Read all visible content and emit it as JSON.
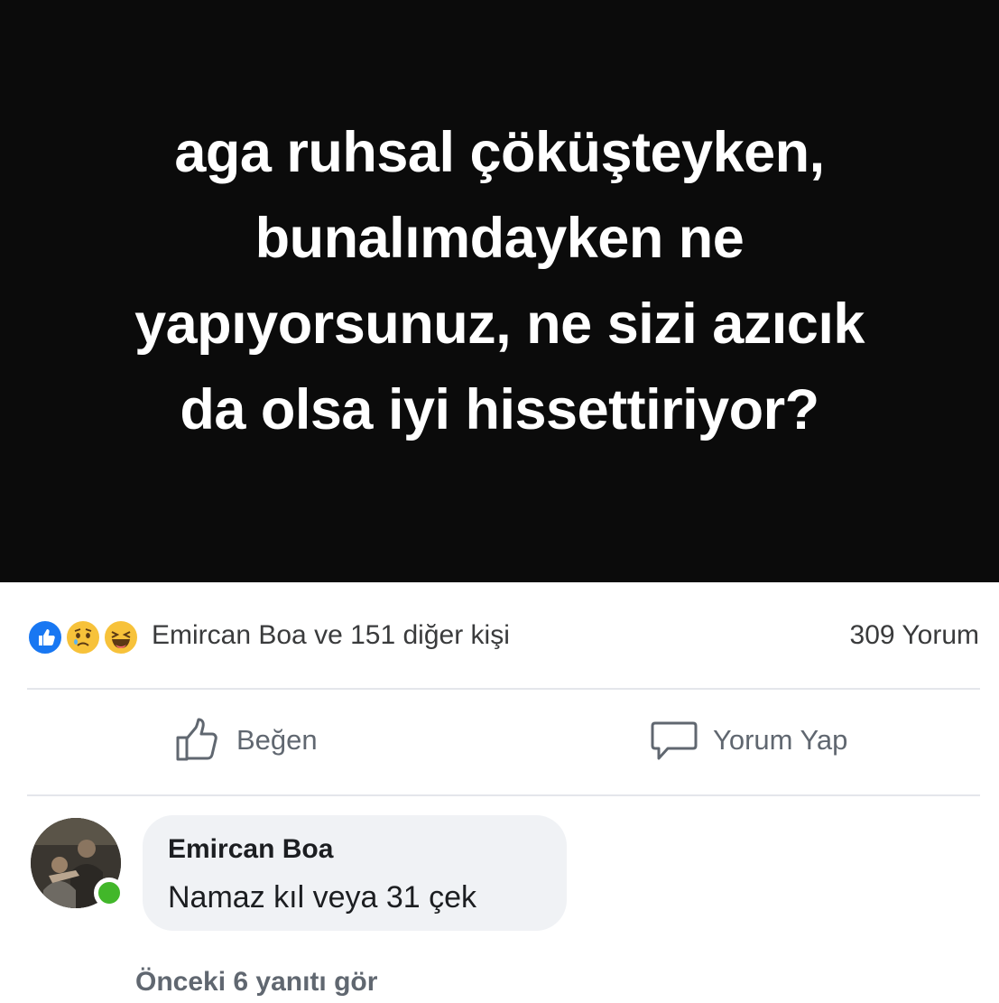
{
  "post": {
    "image_text_lines": [
      "aga ruhsal çöküşteyken,",
      "bunalımdayken ne",
      "yapıyorsunuz, ne sizi azıcık",
      "da olsa iyi hissettiriyor?"
    ]
  },
  "reactions": {
    "icons": [
      "like-icon",
      "sad-icon",
      "haha-icon"
    ],
    "summary": "Emircan Boa ve 151 diğer kişi",
    "comment_count": "309 Yorum"
  },
  "actions": {
    "like_label": "Beğen",
    "comment_label": "Yorum Yap"
  },
  "comment": {
    "author": "Emircan Boa",
    "text": "Namaz kıl veya 31 çek",
    "online_color": "#42b72a"
  },
  "replies": {
    "view_previous": "Önceki 6 yanıtı gör"
  },
  "colors": {
    "post_background": "#0b0b0b",
    "like_blue": "#1877f2",
    "bubble": "#f0f2f5"
  }
}
